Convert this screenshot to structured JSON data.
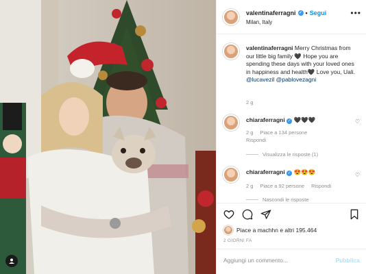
{
  "post": {
    "username": "valentinaferragni",
    "follow_label": "Segui",
    "location": "Milan, Italy",
    "more_label": "•••"
  },
  "comments": [
    {
      "username": "valentinaferragni",
      "text": "Merry Christmas from our little big family 🖤 Hope you are spending these days with your loved ones in happiness and health🖤 Love you, Uali.",
      "mentions": "@lucavezil @pablovezagni",
      "time": "2 g"
    },
    {
      "username": "chiaraferragni",
      "text": "🖤🖤🖤",
      "time": "2 g",
      "likes": "Piace a 134 persone",
      "reply": "Rispondi",
      "view_replies": "Visualizza le risposte (1)"
    },
    {
      "username": "chiaraferragni",
      "text": "😍😍😍",
      "time": "2 g",
      "likes": "Piace a 92 persone",
      "reply": "Rispondi",
      "hide_replies": "Nascondi le risposte"
    }
  ],
  "actions": {
    "likes_text": "Piace a machhn e altri 195.464",
    "date": "2 GIORNI FA",
    "comment_placeholder": "Aggiungi un commento...",
    "publish_label": "Pubblica"
  },
  "icons": [
    "heart-icon",
    "comment-icon",
    "share-icon",
    "bookmark-icon",
    "tag-user-icon",
    "verified-badge-icon"
  ]
}
